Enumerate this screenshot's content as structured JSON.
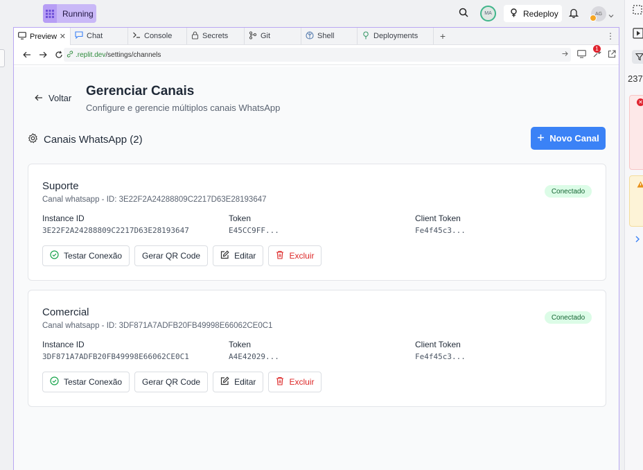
{
  "topbar": {
    "run_label": "Running",
    "user_initials": "MA",
    "redeploy_label": "Redeploy",
    "account_initials": "AG"
  },
  "tabs": [
    {
      "label": "Preview",
      "icon": "monitor-icon",
      "active": true
    },
    {
      "label": "Chat",
      "icon": "chat-icon"
    },
    {
      "label": "Console",
      "icon": "terminal-icon"
    },
    {
      "label": "Secrets",
      "icon": "lock-icon"
    },
    {
      "label": "Git",
      "icon": "git-icon"
    },
    {
      "label": "Shell",
      "icon": "shell-icon"
    },
    {
      "label": "Deployments",
      "icon": "deploy-icon"
    }
  ],
  "url": {
    "host": ".replit.dev",
    "path": "/settings/channels",
    "notification_count": "1"
  },
  "page": {
    "back_label": "Voltar",
    "title": "Gerenciar Canais",
    "subtitle": "Configure e gerencie múltiplos canais WhatsApp",
    "section_title": "Canais WhatsApp (2)",
    "new_button": "Novo Canal"
  },
  "field_labels": {
    "instance": "Instance ID",
    "token": "Token",
    "client_token": "Client Token"
  },
  "actions": {
    "test": "Testar Conexão",
    "qr": "Gerar QR Code",
    "edit": "Editar",
    "delete": "Excluir"
  },
  "channels": [
    {
      "name": "Suporte",
      "description": "Canal whatsapp - ID: 3E22F2A24288809C2217D63E28193647",
      "status": "Conectado",
      "instance_id": "3E22F2A24288809C2217D63E28193647",
      "token": "E45CC9FF...",
      "client_token": "Fe4f45c3..."
    },
    {
      "name": "Comercial",
      "description": "Canal whatsapp - ID: 3DF871A7ADFB20FB49998E66062CE0C1",
      "status": "Conectado",
      "instance_id": "3DF871A7ADFB20FB49998E66062CE0C1",
      "token": "A4E42029...",
      "client_token": "Fe4f45c3..."
    }
  ],
  "right_panel": {
    "count": "237"
  },
  "colors": {
    "accent": "#3b82f6",
    "status_bg": "#dcfce7",
    "status_text": "#166534",
    "danger": "#dc2626",
    "running_pill": "#c9b8f7"
  }
}
